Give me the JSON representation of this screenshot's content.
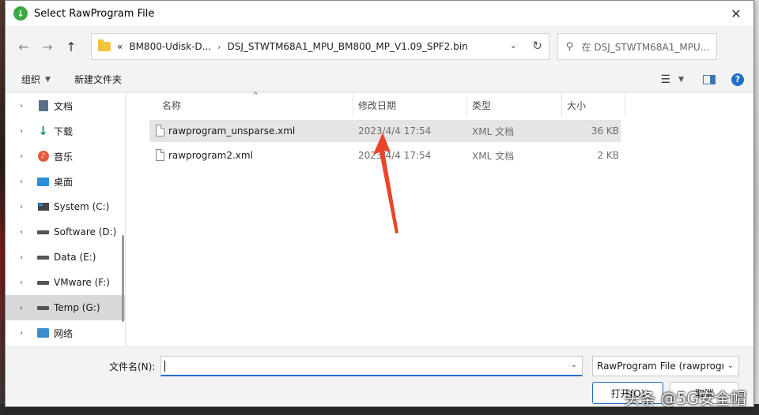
{
  "window": {
    "title": "Select RawProgram File",
    "close_glyph": "✕"
  },
  "address": {
    "overflow": "«",
    "crumbs": [
      "BM800-Udisk-D...",
      "DSJ_STWTM68A1_MPU_BM800_MP_V1.09_SPF2.bin"
    ],
    "separator": "›"
  },
  "search": {
    "placeholder": "在 DSJ_STWTM68A1_MPU..."
  },
  "toolbar": {
    "organize": "组织",
    "new_folder": "新建文件夹",
    "help": "?"
  },
  "sidebar": {
    "items": [
      {
        "label": "文档",
        "icon": "documents-icon"
      },
      {
        "label": "下载",
        "icon": "download-icon"
      },
      {
        "label": "音乐",
        "icon": "music-icon"
      },
      {
        "label": "桌面",
        "icon": "desktop-icon"
      },
      {
        "label": "System (C:)",
        "icon": "system-drive-icon"
      },
      {
        "label": "Software (D:)",
        "icon": "drive-icon"
      },
      {
        "label": "Data (E:)",
        "icon": "drive-icon"
      },
      {
        "label": "VMware (F:)",
        "icon": "drive-icon"
      },
      {
        "label": "Temp (G:)",
        "icon": "drive-icon",
        "selected": true
      },
      {
        "label": "网络",
        "icon": "network-icon"
      }
    ]
  },
  "columns": {
    "name": "名称",
    "date": "修改日期",
    "type": "类型",
    "size": "大小"
  },
  "files": [
    {
      "name": "rawprogram_unsparse.xml",
      "date": "2023/4/4 17:54",
      "type": "XML 文档",
      "size": "36 KB"
    },
    {
      "name": "rawprogram2.xml",
      "date": "2023/4/4 17:54",
      "type": "XML 文档",
      "size": "2 KB"
    }
  ],
  "footer": {
    "filename_label": "文件名(N):",
    "filename_value": "",
    "filter": "RawProgram File (rawprogram*.xml)",
    "open": "打开(O)",
    "cancel": "取消"
  },
  "watermark": "头条 @5G安全帽",
  "colors": {
    "accent": "#1e6ec8",
    "annotation_arrow": "#e8452c"
  }
}
